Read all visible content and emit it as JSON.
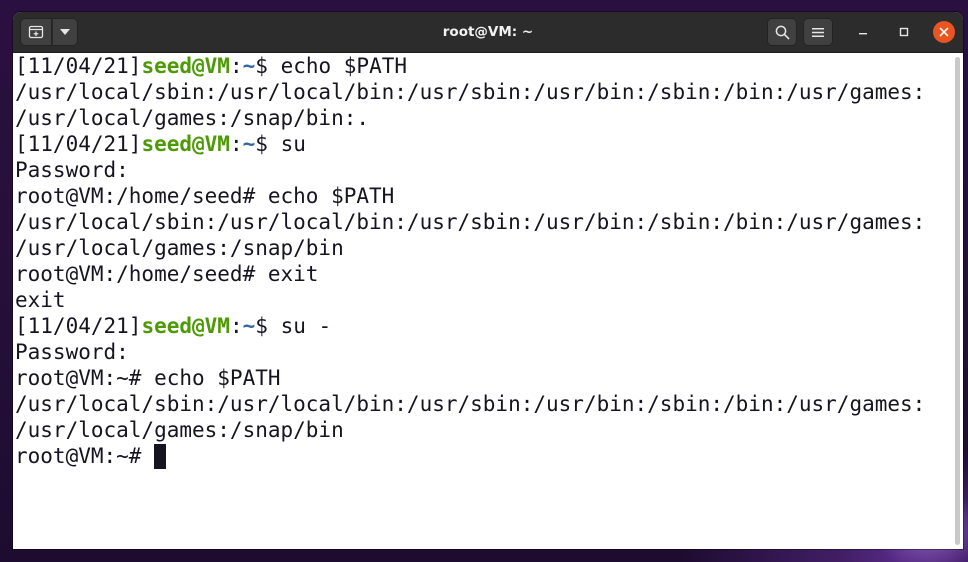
{
  "window": {
    "title": "root@VM: ~"
  },
  "icons": {
    "new_tab": "new-tab-icon",
    "dropdown": "chevron-down-icon",
    "search": "search-icon",
    "menu": "hamburger-menu-icon",
    "minimize": "minimize-icon",
    "maximize": "maximize-icon",
    "close": "close-icon"
  },
  "colors": {
    "titlebar": "#2c2c2c",
    "prompt_user": "#4e9a06",
    "prompt_path": "#3465a4",
    "close_button": "#e95420",
    "terminal_text": "#171421",
    "terminal_bg": "#ffffff"
  },
  "terminal": {
    "lines": [
      {
        "kind": "prompt",
        "date": "[11/04/21]",
        "user": "seed@VM",
        "colon": ":",
        "path": "~",
        "symbol": "$ ",
        "cmd": "echo $PATH"
      },
      {
        "kind": "text",
        "text": "/usr/local/sbin:/usr/local/bin:/usr/sbin:/usr/bin:/sbin:/bin:/usr/games:"
      },
      {
        "kind": "text",
        "text": "/usr/local/games:/snap/bin:."
      },
      {
        "kind": "prompt",
        "date": "[11/04/21]",
        "user": "seed@VM",
        "colon": ":",
        "path": "~",
        "symbol": "$ ",
        "cmd": "su"
      },
      {
        "kind": "text",
        "text": "Password:"
      },
      {
        "kind": "text",
        "text": "root@VM:/home/seed# echo $PATH"
      },
      {
        "kind": "text",
        "text": "/usr/local/sbin:/usr/local/bin:/usr/sbin:/usr/bin:/sbin:/bin:/usr/games:"
      },
      {
        "kind": "text",
        "text": "/usr/local/games:/snap/bin"
      },
      {
        "kind": "text",
        "text": "root@VM:/home/seed# exit"
      },
      {
        "kind": "text",
        "text": "exit"
      },
      {
        "kind": "prompt",
        "date": "[11/04/21]",
        "user": "seed@VM",
        "colon": ":",
        "path": "~",
        "symbol": "$ ",
        "cmd": "su -"
      },
      {
        "kind": "text",
        "text": "Password:"
      },
      {
        "kind": "text",
        "text": "root@VM:~# echo $PATH"
      },
      {
        "kind": "text",
        "text": "/usr/local/sbin:/usr/local/bin:/usr/sbin:/usr/bin:/sbin:/bin:/usr/games:"
      },
      {
        "kind": "text",
        "text": "/usr/local/games:/snap/bin"
      },
      {
        "kind": "text",
        "text": "root@VM:~# "
      }
    ]
  }
}
